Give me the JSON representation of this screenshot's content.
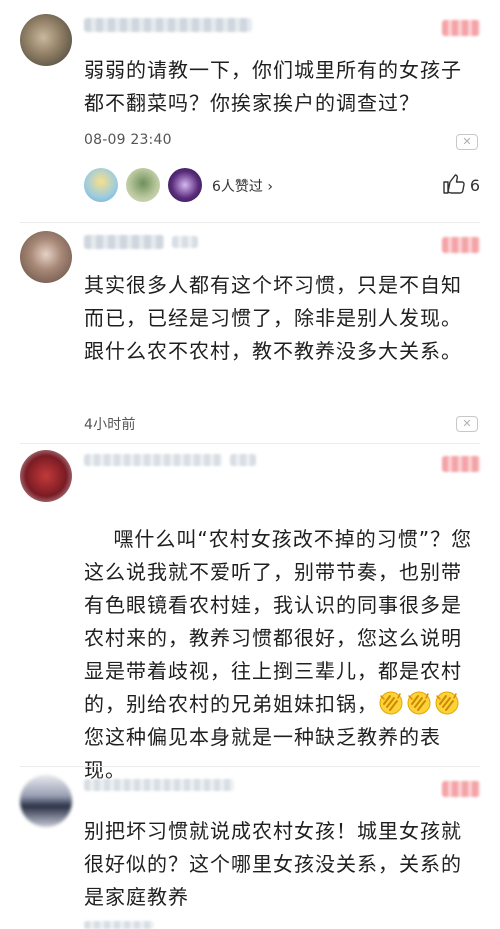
{
  "comments": [
    {
      "text": "弱弱的请教一下，你们城里所有的女孩子都不翻菜吗？你挨家挨户的调查过？",
      "time": "08-09 23:40",
      "liked_by": "6人赞过 ›",
      "like_count": "6"
    },
    {
      "text": "其实很多人都有这个坏习惯，只是不自知而已，已经是习惯了，除非是别人发现。跟什么农不农村，教不教养没多大关系。",
      "time": "4小时前"
    },
    {
      "text_main": "嘿什么叫“农村女孩改不掉的习惯”？您这么说我就不爱听了，别带节奏，也别带有色眼镜看农村娃，我认识的同事很多是农村来的，教养习惯都很好，您这么说明显是带着歧视，往上捯三辈儿，都是农村的，别给农村的兄弟姐妹扣锅，",
      "text_tail": "您这种偏见本身就是一种缺乏教养的表现。",
      "emoji_count": 3
    },
    {
      "text": "别把坏习惯就说成农村女孩！城里女孩就很好似的？这个哪里女孩没关系，关系的是家庭教养"
    }
  ],
  "icons": {
    "report": "close-x-icon",
    "thumb": "thumbs-up-icon",
    "emoji": "clapping-hands-emoji"
  },
  "colors": {
    "text": "#1f1f1f",
    "meta": "#555555",
    "divider": "#ececec",
    "likes_blur": "#f4a2a6"
  }
}
